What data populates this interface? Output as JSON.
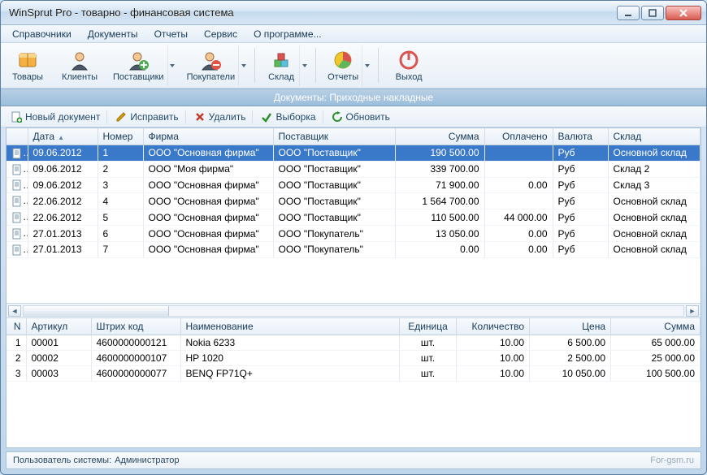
{
  "window": {
    "title": "WinSprut Pro - товарно - финансовая система"
  },
  "menu": {
    "items": [
      "Справочники",
      "Документы",
      "Отчеты",
      "Сервис",
      "О программе..."
    ]
  },
  "toolbar": [
    {
      "label": "Товары",
      "icon": "box",
      "dropdown": false
    },
    {
      "label": "Клиенты",
      "icon": "person",
      "dropdown": false
    },
    {
      "label": "Поставщики",
      "icon": "person-plus-green",
      "dropdown": true
    },
    {
      "label": "Покупатели",
      "icon": "person-minus-red",
      "dropdown": true
    },
    {
      "label": "Склад",
      "icon": "blocks",
      "dropdown": true
    },
    {
      "label": "Отчеты",
      "icon": "pie",
      "dropdown": true
    },
    {
      "label": "Выход",
      "icon": "power",
      "dropdown": false
    }
  ],
  "section_header": "Документы: Приходные накладные",
  "actions": [
    {
      "label": "Новый документ",
      "icon": "file-new",
      "color": "#2e8f2e"
    },
    {
      "label": "Исправить",
      "icon": "pencil",
      "color": "#d8a10b"
    },
    {
      "label": "Удалить",
      "icon": "x",
      "color": "#c0392b"
    },
    {
      "label": "Выборка",
      "icon": "check",
      "color": "#2e8f2e"
    },
    {
      "label": "Обновить",
      "icon": "refresh",
      "color": "#2e8f2e"
    }
  ],
  "docs": {
    "columns": [
      "Дата",
      "Номер",
      "Фирма",
      "Поставщик",
      "Сумма",
      "Оплачено",
      "Валюта",
      "Склад"
    ],
    "rows": [
      {
        "date": "09.06.2012",
        "no": "1",
        "firm": "ООО \"Основная фирма\"",
        "supplier": "ООО \"Поставщик\"",
        "sum": "190 500.00",
        "paid": "",
        "cur": "Руб",
        "store": "Основной склад",
        "selected": true
      },
      {
        "date": "09.06.2012",
        "no": "2",
        "firm": "ООО \"Моя фирма\"",
        "supplier": "ООО \"Поставщик\"",
        "sum": "339 700.00",
        "paid": "",
        "cur": "Руб",
        "store": "Склад 2"
      },
      {
        "date": "09.06.2012",
        "no": "3",
        "firm": "ООО \"Основная фирма\"",
        "supplier": "ООО \"Поставщик\"",
        "sum": "71 900.00",
        "paid": "0.00",
        "cur": "Руб",
        "store": "Склад 3"
      },
      {
        "date": "22.06.2012",
        "no": "4",
        "firm": "ООО \"Основная фирма\"",
        "supplier": "ООО \"Поставщик\"",
        "sum": "1 564 700.00",
        "paid": "",
        "cur": "Руб",
        "store": "Основной склад"
      },
      {
        "date": "22.06.2012",
        "no": "5",
        "firm": "ООО \"Основная фирма\"",
        "supplier": "ООО \"Поставщик\"",
        "sum": "110 500.00",
        "paid": "44 000.00",
        "cur": "Руб",
        "store": "Основной склад"
      },
      {
        "date": "27.01.2013",
        "no": "6",
        "firm": "ООО \"Основная фирма\"",
        "supplier": "ООО \"Покупатель\"",
        "sum": "13 050.00",
        "paid": "0.00",
        "cur": "Руб",
        "store": "Основной склад"
      },
      {
        "date": "27.01.2013",
        "no": "7",
        "firm": "ООО \"Основная фирма\"",
        "supplier": "ООО \"Покупатель\"",
        "sum": "0.00",
        "paid": "0.00",
        "cur": "Руб",
        "store": "Основной склад"
      }
    ]
  },
  "items": {
    "columns": [
      "N",
      "Артикул",
      "Штрих код",
      "Наименование",
      "Единица",
      "Количество",
      "Цена",
      "Сумма"
    ],
    "rows": [
      {
        "n": "1",
        "art": "00001",
        "bar": "4600000000121",
        "name": "Nokia 6233",
        "unit": "шт.",
        "qty": "10.00",
        "price": "6 500.00",
        "total": "65 000.00"
      },
      {
        "n": "2",
        "art": "00002",
        "bar": "4600000000107",
        "name": "HP 1020",
        "unit": "шт.",
        "qty": "10.00",
        "price": "2 500.00",
        "total": "25 000.00"
      },
      {
        "n": "3",
        "art": "00003",
        "bar": "4600000000077",
        "name": "BENQ FP71Q+",
        "unit": "шт.",
        "qty": "10.00",
        "price": "10 050.00",
        "total": "100 500.00"
      }
    ]
  },
  "status": {
    "user_label": "Пользователь системы:",
    "user_value": "Администратор",
    "watermark": "For-gsm.ru"
  }
}
